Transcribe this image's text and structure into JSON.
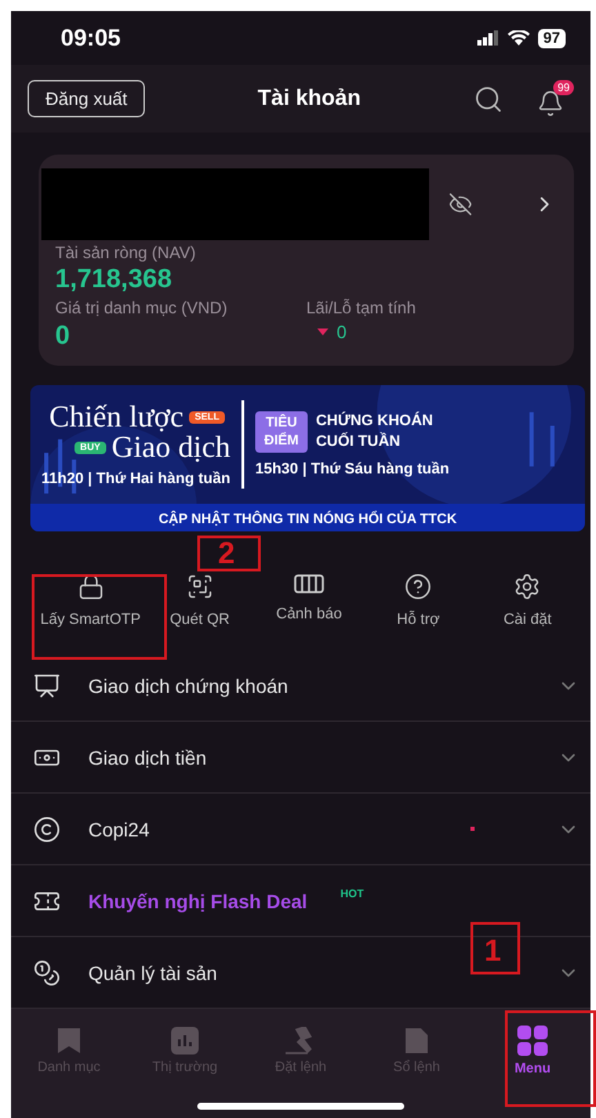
{
  "status_bar": {
    "time": "09:05",
    "battery": "97"
  },
  "header": {
    "logout": "Đăng xuất",
    "title": "Tài khoản",
    "notification_badge": "99"
  },
  "account_card": {
    "nav_label": "Tài sản ròng (NAV)",
    "nav_value": "1,718,368",
    "portfolio_label": "Giá trị danh mục (VND)",
    "portfolio_value": "0",
    "pnl_label": "Lãi/Lỗ tạm tính",
    "pnl_value": "0"
  },
  "banner": {
    "left_title_1": "Chiến lược",
    "sell_tag": "SELL",
    "buy_tag": "BUY",
    "left_title_2": "Giao dịch",
    "left_time": "11h20 | Thứ Hai hàng tuần",
    "focus_tag": "TIÊU ĐIỂM",
    "right_title": "CHỨNG KHOÁN CUỐI TUẦN",
    "right_time": "15h30 | Thứ Sáu hàng tuần",
    "footer": "CẬP NHẬT THÔNG TIN NÓNG HỔI CỦA TTCK"
  },
  "quick_actions": [
    {
      "kind": "lock",
      "label": "Lấy SmartOTP"
    },
    {
      "kind": "qr",
      "label": "Quét QR"
    },
    {
      "kind": "alert",
      "label": "Cảnh báo"
    },
    {
      "kind": "help",
      "label": "Hỗ trợ"
    },
    {
      "kind": "settings",
      "label": "Cài đặt"
    }
  ],
  "menu": [
    {
      "kind": "accordion",
      "label": "Giao dịch chứng khoán",
      "dot": false
    },
    {
      "kind": "accordion",
      "label": "Giao dịch tiền",
      "dot": false
    },
    {
      "kind": "accordion",
      "label": "Copi24",
      "dot": true
    },
    {
      "kind": "link",
      "label": "Khuyến nghị Flash Deal",
      "badge": "HOT",
      "dot": false
    },
    {
      "kind": "accordion",
      "label": "Quản lý tài sản",
      "dot": false
    }
  ],
  "bottom_nav": [
    {
      "label": "Danh mục",
      "selected": false
    },
    {
      "label": "Thị trường",
      "selected": false
    },
    {
      "label": "Đặt lệnh",
      "selected": false
    },
    {
      "label": "Sổ lệnh",
      "selected": false
    },
    {
      "label": "Menu",
      "selected": true
    }
  ],
  "annotations": [
    {
      "kind": "number",
      "label": "2"
    },
    {
      "kind": "number",
      "label": "1"
    }
  ]
}
